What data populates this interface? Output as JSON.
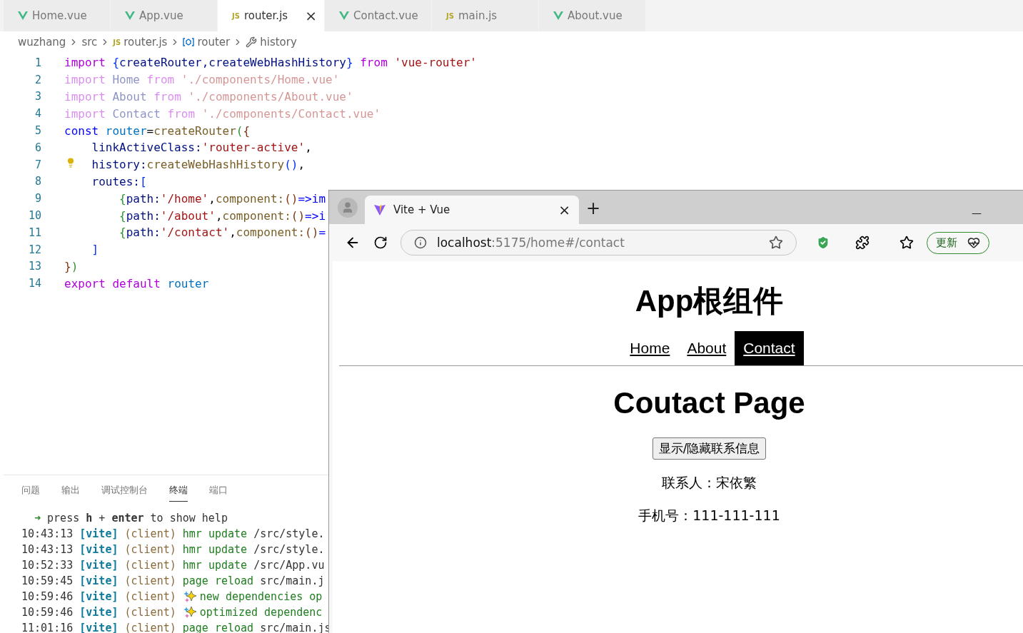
{
  "editor": {
    "tabs": [
      {
        "label": "Home.vue",
        "kind": "vue",
        "selected": false
      },
      {
        "label": "App.vue",
        "kind": "vue",
        "selected": false
      },
      {
        "label": "router.js",
        "kind": "js",
        "icon_text": "JS",
        "selected": true,
        "close": "×"
      },
      {
        "label": "Contact.vue",
        "kind": "vue",
        "selected": false
      },
      {
        "label": "main.js",
        "kind": "js",
        "icon_text": "JS",
        "selected": false
      },
      {
        "label": "About.vue",
        "kind": "vue",
        "selected": false
      }
    ],
    "breadcrumb": [
      {
        "label": "wuzhang",
        "kind": "folder"
      },
      {
        "label": "src",
        "kind": "folder"
      },
      {
        "label": "router.js",
        "kind": "js",
        "icon_text": "JS"
      },
      {
        "label": "router",
        "kind": "variable"
      },
      {
        "label": "history",
        "kind": "property"
      }
    ],
    "lines": [
      {
        "number": "1",
        "faded": false,
        "hint": false,
        "tokens": [
          {
            "text": "import ",
            "kind": "kw"
          },
          {
            "text": "{",
            "kind": "b1"
          },
          {
            "text": "createRouter,createWebHashHistory",
            "kind": "var"
          },
          {
            "text": "} ",
            "kind": "b1"
          },
          {
            "text": "from ",
            "kind": "kw"
          },
          {
            "text": "'vue-router'",
            "kind": "str"
          }
        ]
      },
      {
        "number": "2",
        "faded": true,
        "hint": false,
        "tokens": [
          {
            "text": "import ",
            "kind": "kw"
          },
          {
            "text": "Home ",
            "kind": "var"
          },
          {
            "text": "from ",
            "kind": "kw"
          },
          {
            "text": "'./components/Home.vue'",
            "kind": "str"
          }
        ]
      },
      {
        "number": "3",
        "faded": true,
        "hint": false,
        "tokens": [
          {
            "text": "import ",
            "kind": "kw"
          },
          {
            "text": "About ",
            "kind": "var"
          },
          {
            "text": "from ",
            "kind": "kw"
          },
          {
            "text": "'./components/About.vue'",
            "kind": "str"
          }
        ]
      },
      {
        "number": "4",
        "faded": true,
        "hint": false,
        "tokens": [
          {
            "text": "import ",
            "kind": "kw"
          },
          {
            "text": "Contact ",
            "kind": "var"
          },
          {
            "text": "from ",
            "kind": "kw"
          },
          {
            "text": "'./components/Contact.vue'",
            "kind": "str"
          }
        ]
      },
      {
        "number": "5",
        "faded": false,
        "hint": false,
        "tokens": [
          {
            "text": "const ",
            "kind": "decl"
          },
          {
            "text": "router",
            "kind": "var2"
          },
          {
            "text": "=",
            "kind": "p"
          },
          {
            "text": "createRouter",
            "kind": "fn"
          },
          {
            "text": "(",
            "kind": "b2"
          },
          {
            "text": "{",
            "kind": "b3"
          }
        ],
        "children": [
          {
            "number": "6",
            "faded": false,
            "hint": false,
            "tokens": [
              {
                "text": "linkActiveClass:",
                "kind": "var"
              },
              {
                "text": "'router-active'",
                "kind": "str"
              },
              {
                "text": ",",
                "kind": "p"
              }
            ]
          },
          {
            "number": "7",
            "faded": false,
            "hint": true,
            "tokens": [
              {
                "text": "history:",
                "kind": "var"
              },
              {
                "text": "createWebHashHistory",
                "kind": "fn"
              },
              {
                "text": "()",
                "kind": "b1"
              },
              {
                "text": ",",
                "kind": "p"
              }
            ]
          },
          {
            "number": "8",
            "faded": false,
            "hint": false,
            "tokens": [
              {
                "text": "routes:",
                "kind": "var"
              },
              {
                "text": "[",
                "kind": "b1"
              }
            ],
            "children": [
              {
                "number": "9",
                "faded": false,
                "hint": false,
                "tokens": [
                  {
                    "text": "{",
                    "kind": "b2"
                  },
                  {
                    "text": "path:",
                    "kind": "var"
                  },
                  {
                    "text": "'/home'",
                    "kind": "str"
                  },
                  {
                    "text": ",",
                    "kind": "p"
                  },
                  {
                    "text": "component:",
                    "kind": "fn"
                  },
                  {
                    "text": "()",
                    "kind": "b3"
                  },
                  {
                    "text": "=>im",
                    "kind": "decl"
                  }
                ]
              },
              {
                "number": "10",
                "faded": false,
                "hint": false,
                "tokens": [
                  {
                    "text": "{",
                    "kind": "b2"
                  },
                  {
                    "text": "path:",
                    "kind": "var"
                  },
                  {
                    "text": "'/about'",
                    "kind": "str"
                  },
                  {
                    "text": ",",
                    "kind": "p"
                  },
                  {
                    "text": "component:",
                    "kind": "fn"
                  },
                  {
                    "text": "()",
                    "kind": "b3"
                  },
                  {
                    "text": "=>i",
                    "kind": "decl"
                  }
                ]
              },
              {
                "number": "11",
                "faded": false,
                "hint": false,
                "tokens": [
                  {
                    "text": "{",
                    "kind": "b2"
                  },
                  {
                    "text": "path:",
                    "kind": "var"
                  },
                  {
                    "text": "'/contact'",
                    "kind": "str"
                  },
                  {
                    "text": ",",
                    "kind": "p"
                  },
                  {
                    "text": "component:",
                    "kind": "fn"
                  },
                  {
                    "text": "()",
                    "kind": "b3"
                  },
                  {
                    "text": "=",
                    "kind": "decl"
                  }
                ]
              }
            ]
          },
          {
            "number": "12",
            "faded": false,
            "hint": false,
            "tokens": [
              {
                "text": "]",
                "kind": "b1"
              }
            ]
          }
        ]
      },
      {
        "number": "13",
        "faded": false,
        "hint": false,
        "tokens": [
          {
            "text": "}",
            "kind": "b3"
          },
          {
            "text": ")",
            "kind": "b2"
          }
        ]
      },
      {
        "number": "14",
        "faded": false,
        "hint": false,
        "tokens": [
          {
            "text": "export default ",
            "kind": "kw"
          },
          {
            "text": "router",
            "kind": "var2"
          }
        ]
      }
    ]
  },
  "panel": {
    "tabs": [
      {
        "label": "问题",
        "selected": false
      },
      {
        "label": "输出",
        "selected": false
      },
      {
        "label": "调试控制台",
        "selected": false
      },
      {
        "label": "终端",
        "selected": true
      },
      {
        "label": "端口",
        "selected": false
      }
    ],
    "prompt": {
      "arrow": "➜",
      "text": "press **h** + **enter** to show help"
    },
    "log": [
      {
        "time": "10:43:13",
        "tag": "[vite]",
        "source": "(client)",
        "message": "hmr update",
        "path": "/src/style.",
        "kind": "plain"
      },
      {
        "time": "10:43:13",
        "tag": "[vite]",
        "source": "(client)",
        "message": "hmr update",
        "path": "/src/style.",
        "kind": "plain"
      },
      {
        "time": "10:52:33",
        "tag": "[vite]",
        "source": "(client)",
        "message": "hmr update",
        "path": "/src/App.vu",
        "kind": "plain"
      },
      {
        "time": "10:59:45",
        "tag": "[vite]",
        "source": "(client)",
        "message": "page reload",
        "path": "src/main.j",
        "kind": "plain"
      },
      {
        "time": "10:59:46",
        "tag": "[vite]",
        "source": "(client)",
        "message": "new dependencies op",
        "kind": "sparkle"
      },
      {
        "time": "10:59:46",
        "tag": "[vite]",
        "source": "(client)",
        "message": "optimized dependenc",
        "kind": "sparkle"
      },
      {
        "time": "11:01:16",
        "tag": "[vite]",
        "source": "(client)",
        "message": "page reload",
        "path": "src/main.js",
        "kind": "plain"
      }
    ]
  },
  "browser": {
    "tab": {
      "title": "Vite + Vue",
      "close": "×"
    },
    "new_tab": "+",
    "minimize": "—",
    "address": {
      "host": "localhost",
      "rest": ":5175/home#/contact"
    },
    "update_button": "更新",
    "page": {
      "title": "App根组件",
      "nav": [
        {
          "label": "Home",
          "selected": false
        },
        {
          "label": "About",
          "selected": false
        },
        {
          "label": "Contact",
          "selected": true
        }
      ],
      "heading": "Coutact Page",
      "toggle_button": "显示/隐藏联系信息",
      "contact": "联系人：宋依繁",
      "phone": "手机号：111-111-111"
    }
  }
}
